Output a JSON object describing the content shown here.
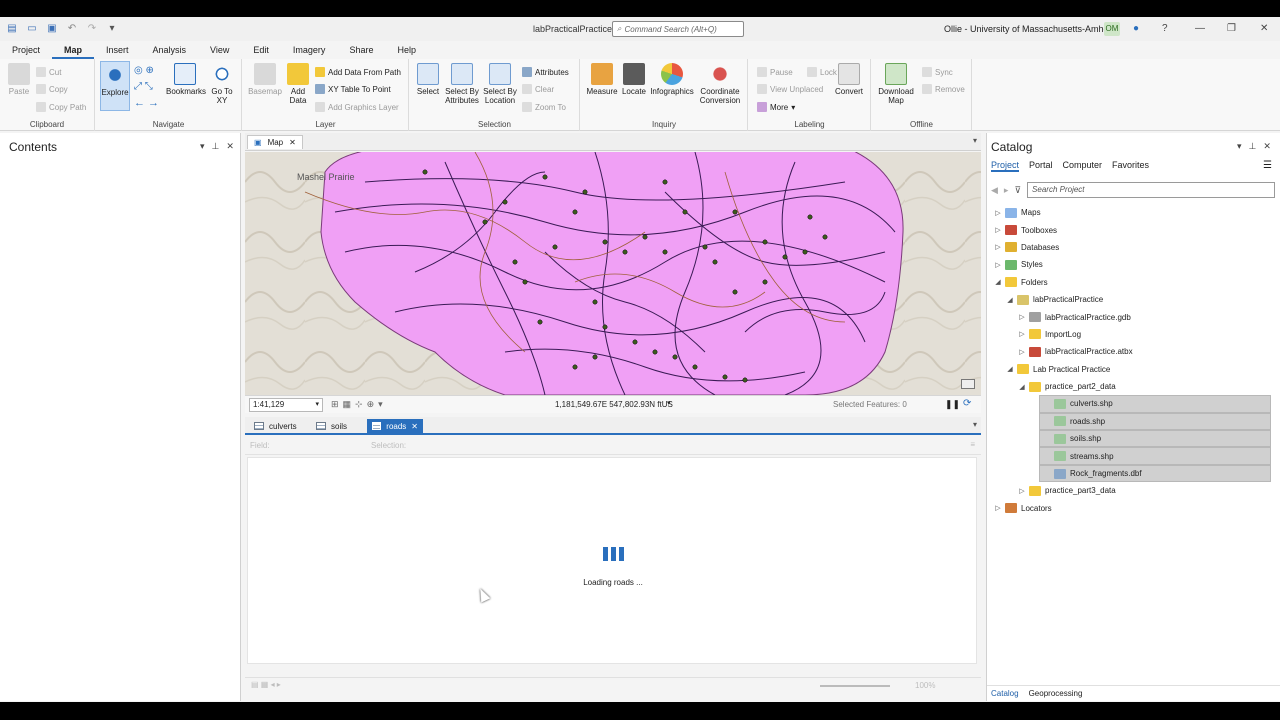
{
  "titlebar": {
    "app_title": "labPracticalPractice",
    "command_search_placeholder": "Command Search (Alt+Q)",
    "user": "Ollie - University of Massachusetts-Amherst",
    "avatar_initials": "OM"
  },
  "ribbon_tabs": [
    "Project",
    "Map",
    "Insert",
    "Analysis",
    "View",
    "Edit",
    "Imagery",
    "Share",
    "Help"
  ],
  "ribbon": {
    "clipboard": {
      "paste": "Paste",
      "cut": "Cut",
      "copy": "Copy",
      "copy_path": "Copy Path",
      "label": "Clipboard"
    },
    "navigate": {
      "explore": "Explore",
      "bookmarks": "Bookmarks",
      "goto_xy": "Go To XY",
      "label": "Navigate"
    },
    "layer": {
      "basemap": "Basemap",
      "add_data": "Add Data",
      "add_data_from_path": "Add Data From Path",
      "xy_table": "XY Table To Point",
      "add_graphics": "Add Graphics Layer",
      "label": "Layer"
    },
    "selection": {
      "select": "Select",
      "select_by_attr": "Select By Attributes",
      "select_by_loc": "Select By Location",
      "attributes": "Attributes",
      "clear": "Clear",
      "zoom_to": "Zoom To",
      "label": "Selection"
    },
    "inquiry": {
      "measure": "Measure",
      "locate": "Locate",
      "infographics": "Infographics",
      "coord_conv": "Coordinate Conversion",
      "label": "Inquiry"
    },
    "labeling": {
      "pause": "Pause",
      "lock": "Lock",
      "view_unplaced": "View Unplaced",
      "more": "More",
      "convert": "Convert",
      "label": "Labeling"
    },
    "offline": {
      "download_map": "Download Map",
      "sync": "Sync",
      "remove": "Remove",
      "label": "Offline"
    }
  },
  "contents": {
    "title": "Contents"
  },
  "map": {
    "tab_label": "Map",
    "place_label": "Mashel Prairie",
    "scale": "1:41,129",
    "coordinates": "1,181,549.67E 547,802.93N ftUS",
    "selected_features": "Selected Features: 0"
  },
  "attribute_tabs": [
    {
      "label": "culverts",
      "active": false
    },
    {
      "label": "soils",
      "active": false
    },
    {
      "label": "roads",
      "active": true
    }
  ],
  "attribute_table": {
    "field_label": "Field:",
    "selection_label": "Selection:",
    "loading_text": "Loading roads ...",
    "zoom": "100%"
  },
  "catalog": {
    "title": "Catalog",
    "subtabs": [
      "Project",
      "Portal",
      "Computer",
      "Favorites"
    ],
    "search_placeholder": "Search Project",
    "tree": [
      {
        "label": "Maps",
        "level": 0,
        "arrow": "right",
        "icon": "maps",
        "selected": false
      },
      {
        "label": "Toolboxes",
        "level": 0,
        "arrow": "right",
        "icon": "toolbox",
        "selected": false
      },
      {
        "label": "Databases",
        "level": 0,
        "arrow": "right",
        "icon": "database",
        "selected": false
      },
      {
        "label": "Styles",
        "level": 0,
        "arrow": "right",
        "icon": "style",
        "selected": false
      },
      {
        "label": "Folders",
        "level": 0,
        "arrow": "down",
        "icon": "folder",
        "selected": false
      },
      {
        "label": "labPracticalPractice",
        "level": 1,
        "arrow": "down",
        "icon": "folder-home",
        "selected": false
      },
      {
        "label": "labPracticalPractice.gdb",
        "level": 2,
        "arrow": "right",
        "icon": "gdb",
        "selected": false
      },
      {
        "label": "ImportLog",
        "level": 2,
        "arrow": "right",
        "icon": "folder",
        "selected": false
      },
      {
        "label": "labPracticalPractice.atbx",
        "level": 2,
        "arrow": "right",
        "icon": "toolbox",
        "selected": false
      },
      {
        "label": "Lab Practical Practice",
        "level": 1,
        "arrow": "down",
        "icon": "folder",
        "selected": false
      },
      {
        "label": "practice_part2_data",
        "level": 2,
        "arrow": "down",
        "icon": "folder",
        "selected": false
      },
      {
        "label": "culverts.shp",
        "level": 3,
        "arrow": "",
        "icon": "shp",
        "selected": true
      },
      {
        "label": "roads.shp",
        "level": 3,
        "arrow": "",
        "icon": "shp",
        "selected": true
      },
      {
        "label": "soils.shp",
        "level": 3,
        "arrow": "",
        "icon": "shp",
        "selected": true
      },
      {
        "label": "streams.shp",
        "level": 3,
        "arrow": "",
        "icon": "shp",
        "selected": true
      },
      {
        "label": "Rock_fragments.dbf",
        "level": 3,
        "arrow": "",
        "icon": "table",
        "selected": true
      },
      {
        "label": "practice_part3_data",
        "level": 2,
        "arrow": "right",
        "icon": "folder",
        "selected": false
      },
      {
        "label": "Locators",
        "level": 0,
        "arrow": "right",
        "icon": "locator",
        "selected": false
      }
    ],
    "bottom_tabs": [
      "Catalog",
      "Geoprocessing"
    ]
  },
  "colors": {
    "accent": "#2a6fbd",
    "soil_polygon": "#f0a0f5",
    "roads": "#3a1a55",
    "streams": "#a0603a"
  }
}
